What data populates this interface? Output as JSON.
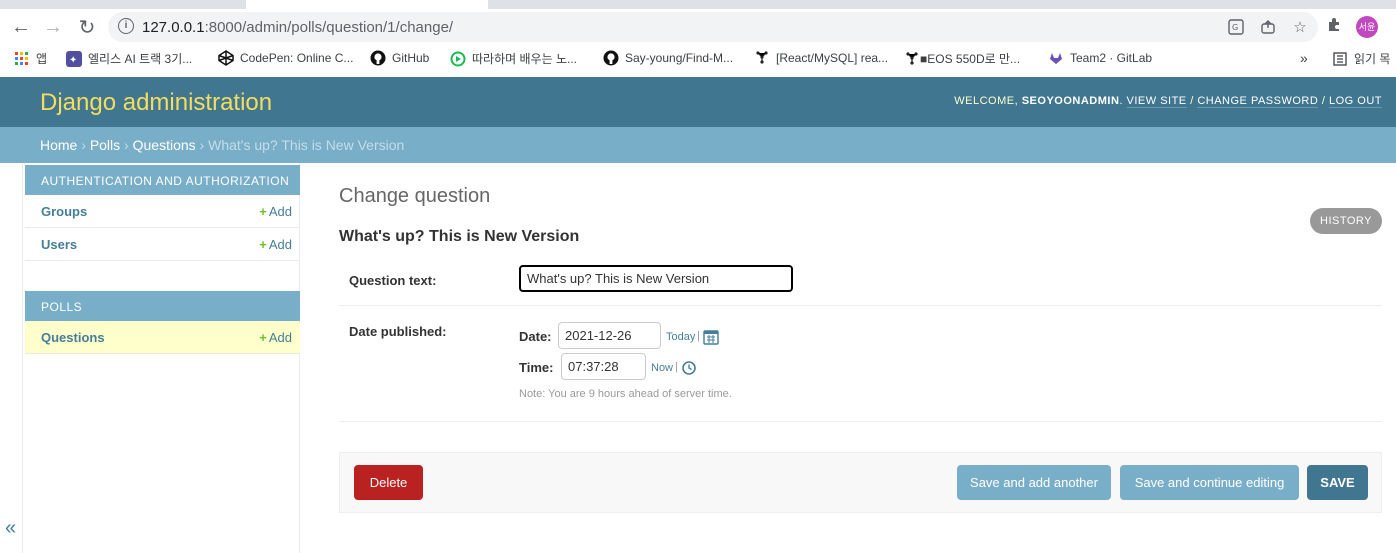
{
  "browser": {
    "url_host": "127.0.0.1",
    "url_path": ":8000/admin/polls/question/1/change/",
    "profile_initials": "서윤",
    "bookmarks": [
      {
        "label": "앱",
        "icon": "apps-grid-icon"
      },
      {
        "label": "엘리스 AI 트랙 3기...",
        "icon": "elice-icon"
      },
      {
        "label": "CodePen: Online C...",
        "icon": "codepen-icon"
      },
      {
        "label": "GitHub",
        "icon": "github-icon"
      },
      {
        "label": "따라하며 배우는 노...",
        "icon": "course-icon"
      },
      {
        "label": "Say-young/Find-M...",
        "icon": "github-icon"
      },
      {
        "label": "[React/MySQL] rea...",
        "icon": "tree-icon"
      },
      {
        "label": "■EOS 550D로 만...",
        "icon": "tree-icon"
      },
      {
        "label": "Team2 · GitLab",
        "icon": "gitlab-icon"
      }
    ],
    "reading_list": "읽기 목"
  },
  "header": {
    "branding": "Django administration",
    "welcome": "Welcome,",
    "username": "seoyoonadmin",
    "view_site": "View site",
    "change_password": "Change password",
    "log_out": "Log out"
  },
  "breadcrumbs": {
    "home": "Home",
    "app": "Polls",
    "model": "Questions",
    "current": "What's up? This is New Version"
  },
  "sidebar": {
    "modules": [
      {
        "caption": "Authentication and Authorization",
        "rows": [
          {
            "name": "Groups",
            "add": "Add"
          },
          {
            "name": "Users",
            "add": "Add"
          }
        ]
      },
      {
        "caption": "Polls",
        "rows": [
          {
            "name": "Questions",
            "add": "Add"
          }
        ]
      }
    ],
    "collapse": "«"
  },
  "content": {
    "title": "Change question",
    "history": "History",
    "object_title": "What's up? This is New Version",
    "question_label": "Question text:",
    "question_value": "What's up? This is New Version",
    "date_published_label": "Date published:",
    "date_label": "Date:",
    "date_value": "2021-12-26",
    "today_link": "Today",
    "time_label": "Time:",
    "time_value": "07:37:28",
    "now_link": "Now",
    "separator": "|",
    "help_text": "Note: You are 9 hours ahead of server time."
  },
  "submit": {
    "delete": "Delete",
    "save_add_another": "Save and add another",
    "save_continue": "Save and continue editing",
    "save": "SAVE"
  },
  "colors": {
    "header_bg": "#417690",
    "branding": "#f5dd5d",
    "breadcrumb_bg": "#79aec8",
    "delete": "#ba2121",
    "add_green": "#70bf2b"
  }
}
